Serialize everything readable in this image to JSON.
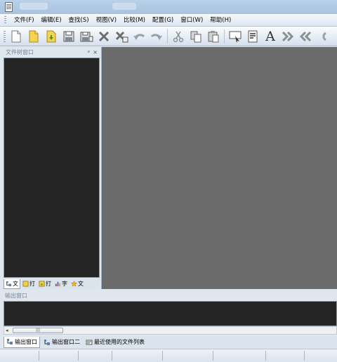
{
  "menu": {
    "items": [
      {
        "label": "文件(F)"
      },
      {
        "label": "编辑(E)"
      },
      {
        "label": "查找(S)"
      },
      {
        "label": "视图(V)"
      },
      {
        "label": "比较(M)"
      },
      {
        "label": "配置(G)"
      },
      {
        "label": "窗口(W)"
      },
      {
        "label": "帮助(H)"
      }
    ]
  },
  "toolbar": {
    "buttons": [
      {
        "icon": "new-file-icon"
      },
      {
        "icon": "open-file-icon"
      },
      {
        "icon": "open-folder-icon"
      },
      {
        "icon": "save-icon"
      },
      {
        "icon": "save-all-icon"
      },
      {
        "icon": "close-icon"
      },
      {
        "icon": "close-all-icon"
      },
      {
        "icon": "undo-icon"
      },
      {
        "icon": "redo-icon"
      },
      {
        "icon": "cut-icon"
      },
      {
        "icon": "copy-icon"
      },
      {
        "icon": "paste-icon"
      },
      {
        "icon": "find-icon"
      },
      {
        "icon": "replace-icon"
      },
      {
        "icon": "font-icon"
      },
      {
        "icon": "indent-icon"
      },
      {
        "icon": "outdent-icon"
      }
    ],
    "font_glyph": "A"
  },
  "left_panel": {
    "title": "文件树窗口",
    "pin_glyph": "ᵖ",
    "close_glyph": "×",
    "tabs": [
      {
        "label": "文",
        "icon": "file-tree-icon",
        "active": true
      },
      {
        "label": "打",
        "icon": "open-files-icon",
        "active": false
      },
      {
        "label": "打",
        "icon": "open-folder-icon",
        "active": false
      },
      {
        "label": "字",
        "icon": "function-list-icon",
        "active": false
      },
      {
        "label": "文",
        "icon": "favorites-icon",
        "active": false
      }
    ]
  },
  "output_panel": {
    "title": "输出窗口",
    "scroll_thumb": "|||",
    "scroll_left": "◂",
    "tabs": [
      {
        "label": "输出窗口",
        "icon": "output-icon",
        "active": true
      },
      {
        "label": "输出窗口二",
        "icon": "output-icon",
        "active": false
      },
      {
        "label": "最近使用的文件列表",
        "icon": "recent-files-icon",
        "active": false
      }
    ]
  },
  "colors": {
    "editor_background": "#6b6b6b",
    "panel_background": "#242424",
    "chrome": "#dfe6ee"
  }
}
